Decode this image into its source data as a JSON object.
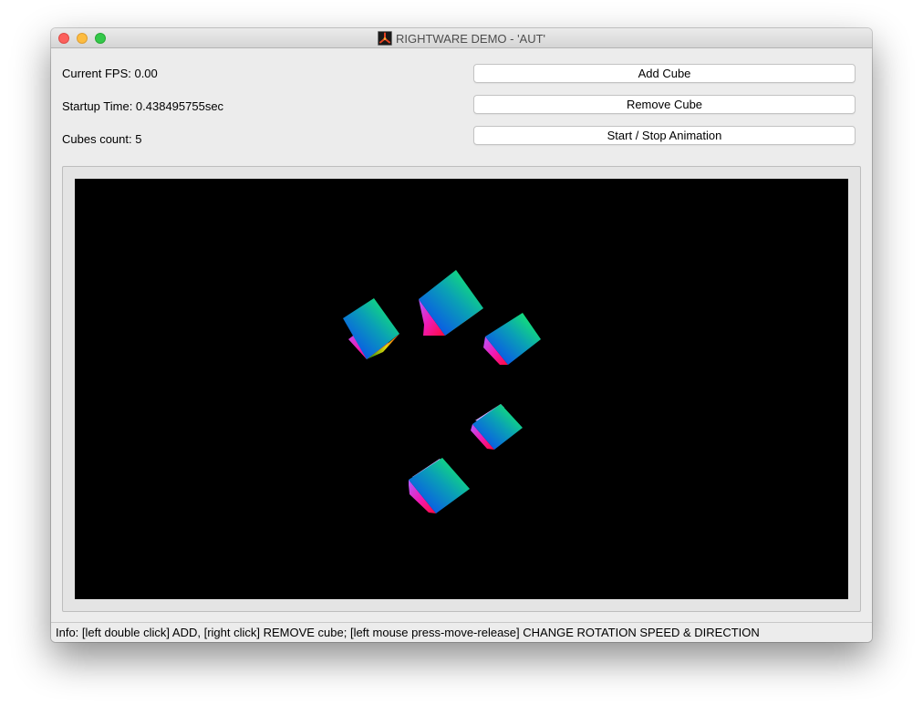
{
  "window": {
    "title": "RIGHTWARE DEMO - 'AUT'"
  },
  "stats": {
    "fps_label": "Current FPS: 0.00",
    "startup_label": "Startup Time: 0.438495755sec",
    "cubes_label": "Cubes count: 5"
  },
  "buttons": {
    "add_cube": "Add Cube",
    "remove_cube": "Remove Cube",
    "toggle_animation": "Start / Stop Animation"
  },
  "scene": {
    "background_color": "#000000",
    "cube_count": 5,
    "cube_icon": "rainbow-cube-icon"
  },
  "status_bar": {
    "info": "Info: [left double click] ADD, [right click] REMOVE cube; [left mouse press-move-release] CHANGE ROTATION SPEED & DIRECTION"
  },
  "colors": {
    "close": "#fc605c",
    "minimize": "#fdbc40",
    "maximize": "#34c84a",
    "window_bg": "#ececec"
  }
}
